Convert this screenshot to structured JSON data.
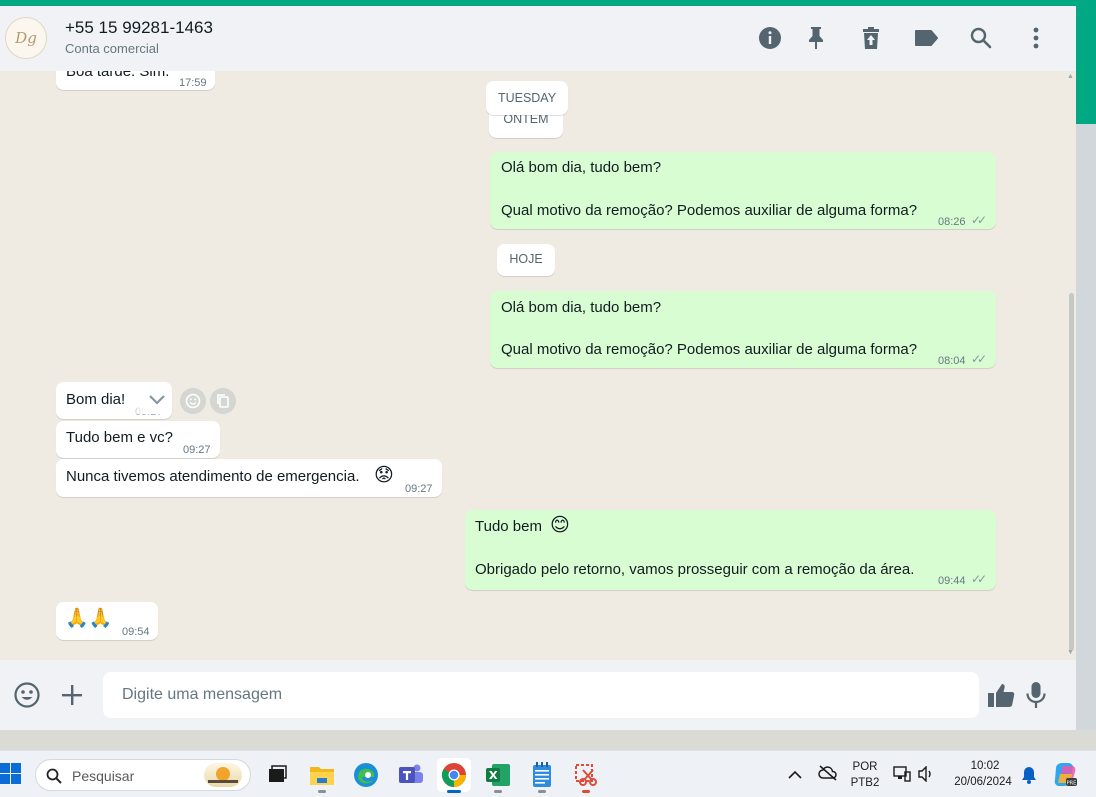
{
  "header": {
    "avatar_initials": "Dg",
    "contact_name": "+55 15 99281-1463",
    "contact_subtitle": "Conta comercial",
    "icons": [
      "info-icon",
      "pin-icon",
      "delete-icon",
      "label-icon",
      "search-icon",
      "menu-icon"
    ]
  },
  "chat": {
    "date_chips": [
      "TUESDAY",
      "ONTEM",
      "HOJE"
    ],
    "messages": [
      {
        "direction": "in",
        "text": "Boa tarde. Sim.",
        "time": "17:59"
      },
      {
        "direction": "out",
        "line1": "Olá bom dia, tudo bem?",
        "line2": "Qual motivo da remoção? Podemos auxiliar de alguma forma?",
        "time": "08:26",
        "status": "read"
      },
      {
        "direction": "out",
        "line1": "Olá bom dia, tudo bem?",
        "line2": "Qual motivo da remoção? Podemos auxiliar de alguma forma?",
        "time": "08:04",
        "status": "read"
      },
      {
        "direction": "in",
        "text": "Bom dia!",
        "time": "09:27"
      },
      {
        "direction": "in",
        "text": "Tudo bem e vc?",
        "time": "09:27"
      },
      {
        "direction": "in",
        "text": "Nunca tivemos atendimento de emergencia.",
        "emoji": "😟",
        "time": "09:27"
      },
      {
        "direction": "out",
        "line1": "Tudo bem",
        "line1_emoji": "😊",
        "line2": "Obrigado pelo retorno, vamos prosseguir com a remoção da área.",
        "time": "09:44",
        "status": "read"
      },
      {
        "direction": "in",
        "text": "🙏🙏",
        "time": "09:54"
      }
    ],
    "hover_actions": [
      "chevron-down-icon",
      "react-emoji-icon",
      "copy-icon"
    ]
  },
  "composer": {
    "placeholder": "Digite uma mensagem",
    "value": ""
  },
  "taskbar": {
    "search_placeholder": "Pesquisar",
    "apps": [
      "task-view",
      "file-explorer",
      "edge",
      "teams",
      "chrome",
      "excel",
      "notepad",
      "snipping-tool"
    ],
    "active_app": "chrome",
    "lang_top": "POR",
    "lang_bottom": "PTB2",
    "time": "10:02",
    "date": "20/06/2024"
  },
  "colors": {
    "accent": "#00a884",
    "outgoing_bubble": "#d9fdd3",
    "incoming_bubble": "#ffffff",
    "chat_bg": "#efeae2",
    "read_ticks": "#8696a0"
  }
}
